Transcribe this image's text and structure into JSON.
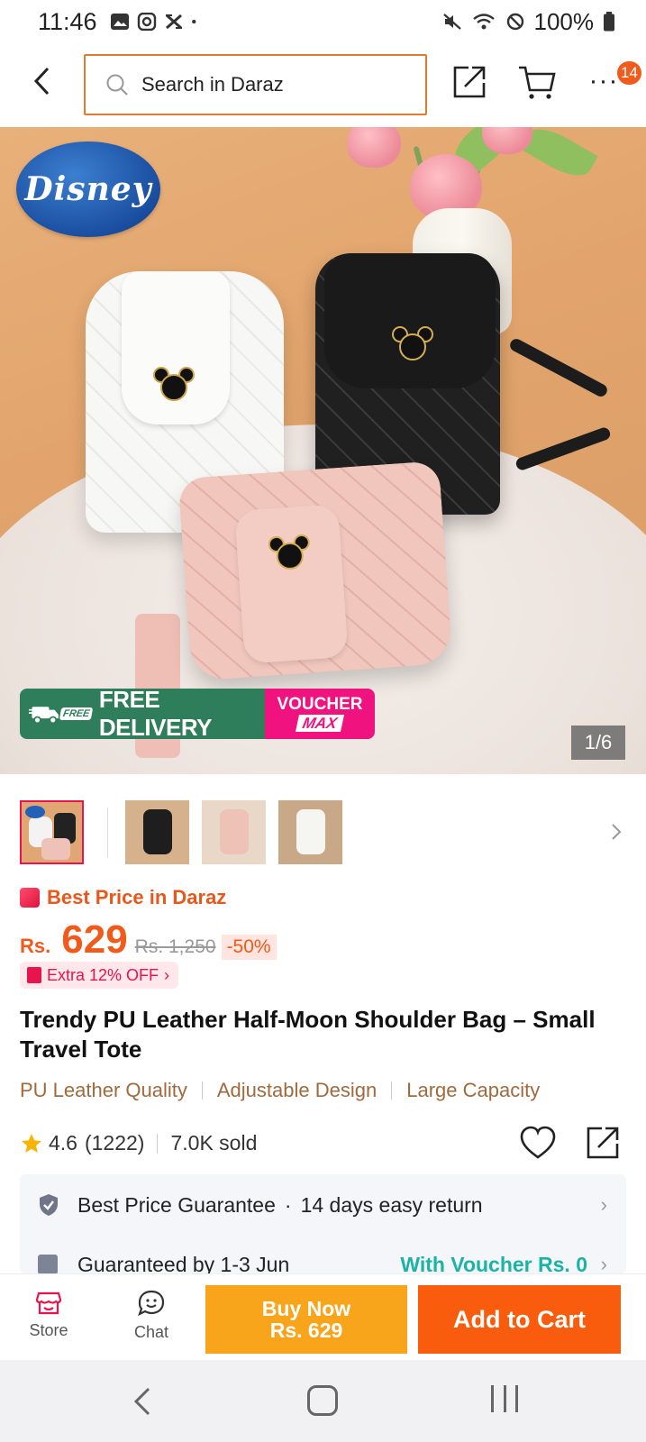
{
  "status_bar": {
    "time": "11:46",
    "battery": "100%",
    "left_icons": [
      "image-icon",
      "instagram-icon",
      "x-icon",
      "dot-icon"
    ],
    "right_icons": [
      "mute-icon",
      "wifi-icon",
      "dnd-icon",
      "battery-icon"
    ]
  },
  "top_nav": {
    "search_placeholder": "Search in Daraz",
    "cart_badge": "14",
    "more": "···"
  },
  "hero": {
    "brand_logo": "Disney",
    "promo_free_tag": "FREE",
    "promo_free": "FREE DELIVERY",
    "promo_voucher_top": "VOUCHER",
    "promo_voucher_max": "MAX",
    "counter": "1/6"
  },
  "product": {
    "best_price_label": "Best Price in Daraz",
    "currency": "Rs.",
    "price": "629",
    "old_price": "Rs. 1,250",
    "discount": "-50%",
    "extra_off": "Extra 12% OFF",
    "title": "Trendy PU Leather Half-Moon Shoulder Bag – Small Travel Tote",
    "features": [
      "PU Leather Quality",
      "Adjustable Design",
      "Large Capacity"
    ],
    "rating": "4.6",
    "rating_count": "(1222)",
    "sold": "7.0K sold"
  },
  "guarantee": {
    "best_price": "Best Price Guarantee",
    "separator": "·",
    "returns": "14 days easy return",
    "delivery": "Guaranteed by 1-3 Jun",
    "voucher": "With Voucher Rs. 0"
  },
  "action_bar": {
    "store": "Store",
    "chat": "Chat",
    "buy_now_line1": "Buy Now",
    "buy_now_line2": "Rs. 629",
    "add_to_cart": "Add to Cart"
  },
  "colors": {
    "accent_orange": "#f05a1a",
    "buy_now": "#f8a51c",
    "add_to_cart": "#f95c0c",
    "free_delivery": "#2e7d5b",
    "voucher_pink": "#f0127e",
    "feature_text": "#a06a3e"
  }
}
